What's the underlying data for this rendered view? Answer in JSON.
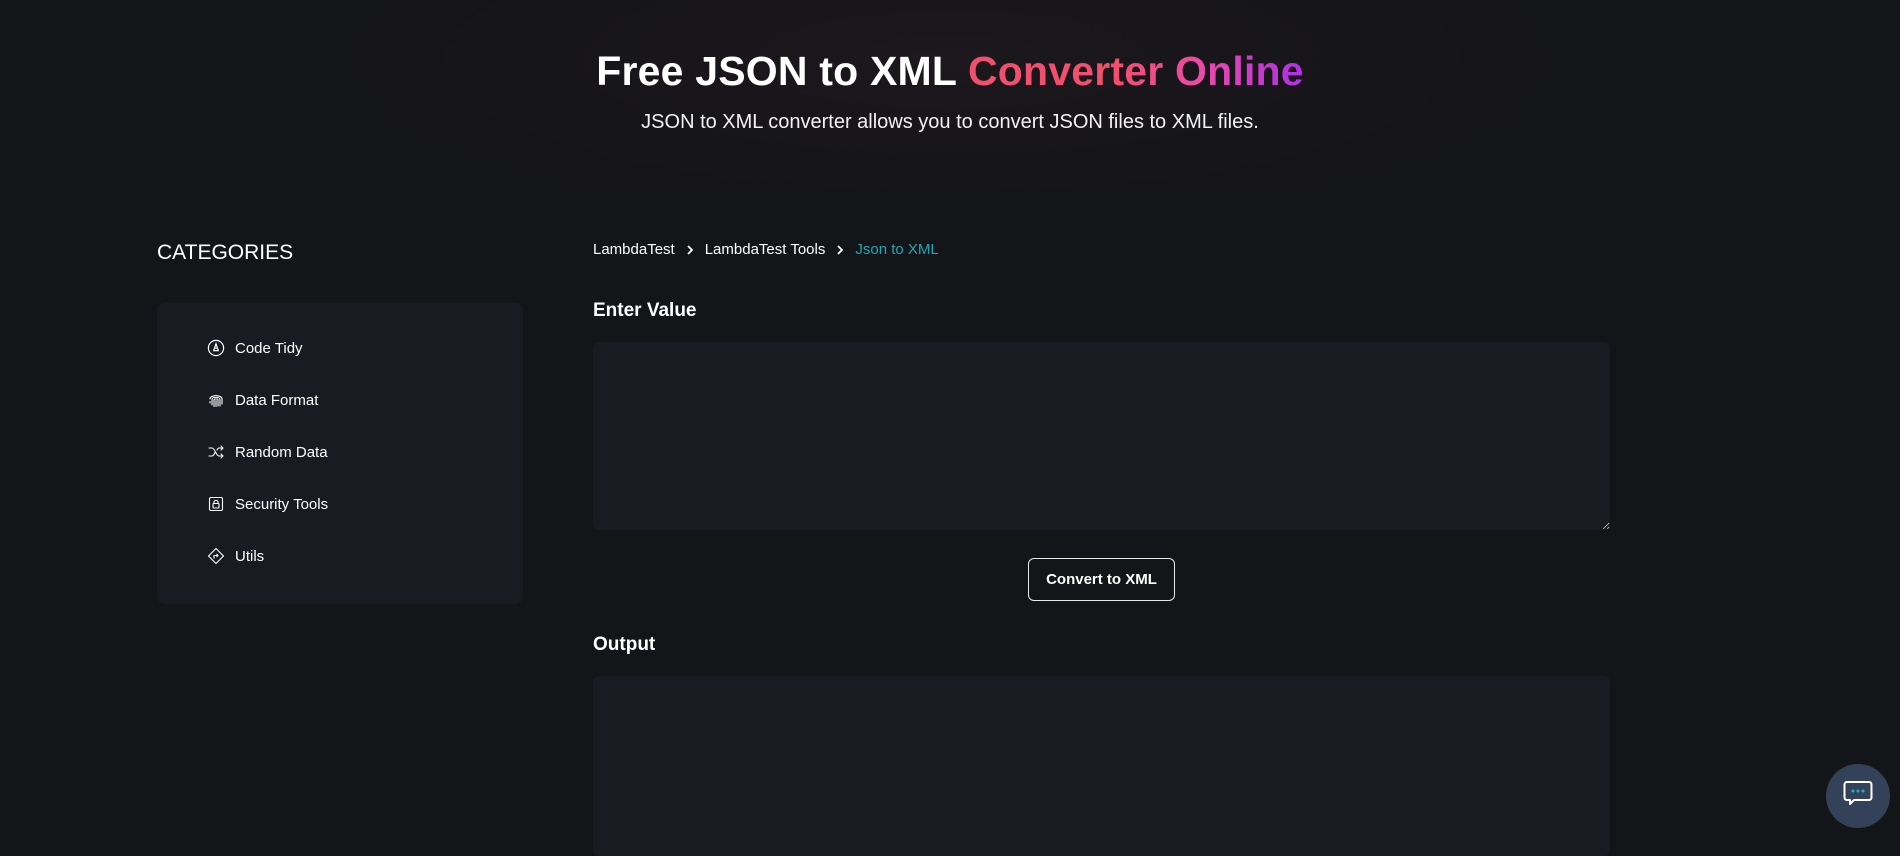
{
  "hero": {
    "title_plain": "Free JSON to XML ",
    "title_accent": "Converter Online",
    "subtitle": "JSON to XML converter allows you to convert JSON files to XML files."
  },
  "sidebar": {
    "heading": "CATEGORIES",
    "items": [
      {
        "label": "Code Tidy",
        "icon": "code-tidy-icon"
      },
      {
        "label": "Data Format",
        "icon": "fingerprint-icon"
      },
      {
        "label": "Random Data",
        "icon": "shuffle-icon"
      },
      {
        "label": "Security Tools",
        "icon": "lock-icon"
      },
      {
        "label": "Utils",
        "icon": "direction-sign-icon"
      }
    ]
  },
  "breadcrumb": {
    "items": [
      "LambdaTest",
      "LambdaTest Tools"
    ],
    "current": "Json to XML"
  },
  "main": {
    "input_label": "Enter Value",
    "input_value": "",
    "convert_label": "Convert to XML",
    "output_label": "Output",
    "output_value": ""
  },
  "colors": {
    "background": "#141518",
    "panel": "#1a1a22",
    "accent_teal": "#17a8b4",
    "gradient_start": "#f0506e",
    "gradient_end": "#b02ee8",
    "chat_button": "#344259"
  },
  "chat": {
    "icon": "chat-bubble-icon"
  }
}
